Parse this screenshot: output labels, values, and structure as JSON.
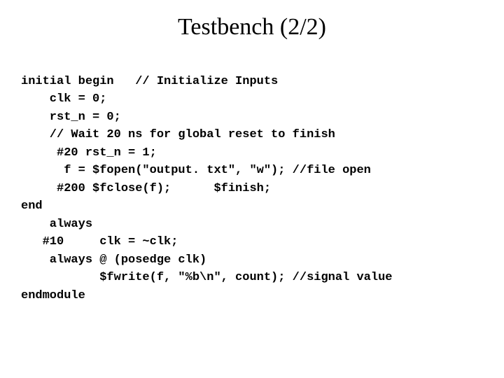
{
  "title": "Testbench (2/2)",
  "code_lines": {
    "l0": "initial begin   // Initialize Inputs",
    "l1": "    clk = 0;",
    "l2": "    rst_n = 0;",
    "l3": "    // Wait 20 ns for global reset to finish",
    "l4": "     #20 rst_n = 1;",
    "l5": "      f = $fopen(\"output. txt\", \"w\"); //file open",
    "l6": "     #200 $fclose(f);      $finish;",
    "l7": "end",
    "l8": "    always",
    "l9": "   #10     clk = ~clk;",
    "l10": "    always @ (posedge clk)",
    "l11": "           $fwrite(f, \"%b\\n\", count); //signal value",
    "l12": "endmodule"
  }
}
